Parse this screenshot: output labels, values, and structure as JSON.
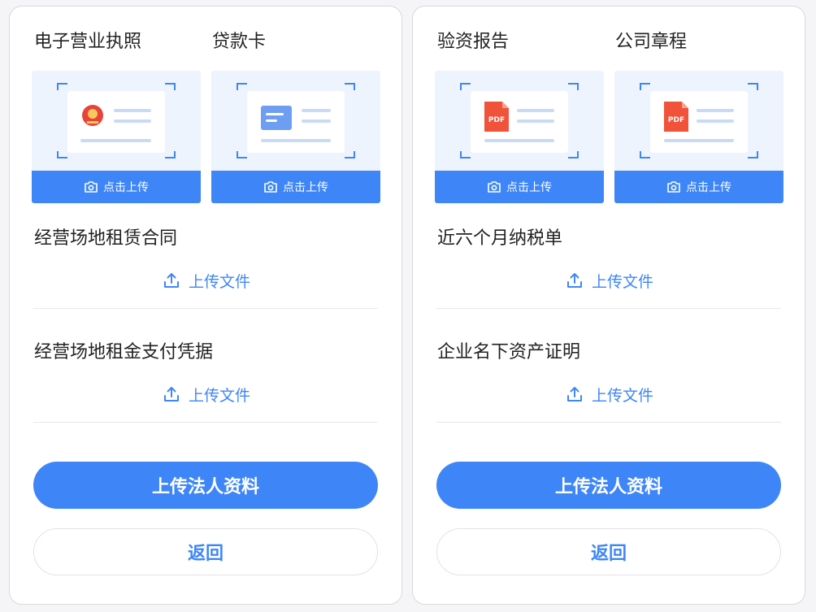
{
  "colors": {
    "accent": "#3e86f7",
    "card_bg": "#eef4fe",
    "pdf_red": "#f0533a",
    "emblem_red": "#e8433b"
  },
  "left_panel": {
    "card_titles": [
      "电子营业执照",
      "贷款卡"
    ],
    "card_button_label": "点击上传",
    "card_icons": [
      "emblem-icon",
      "card-icon"
    ],
    "sections": [
      {
        "title": "经营场地租赁合同",
        "upload_label": "上传文件"
      },
      {
        "title": "经营场地租金支付凭据",
        "upload_label": "上传文件"
      }
    ],
    "primary_button": "上传法人资料",
    "back_button": "返回"
  },
  "right_panel": {
    "card_titles": [
      "验资报告",
      "公司章程"
    ],
    "card_button_label": "点击上传",
    "card_icons": [
      "pdf-icon",
      "pdf-icon"
    ],
    "pdf_badge_text": "PDF",
    "sections": [
      {
        "title": "近六个月纳税单",
        "upload_label": "上传文件"
      },
      {
        "title": "企业名下资产证明",
        "upload_label": "上传文件"
      }
    ],
    "primary_button": "上传法人资料",
    "back_button": "返回"
  }
}
